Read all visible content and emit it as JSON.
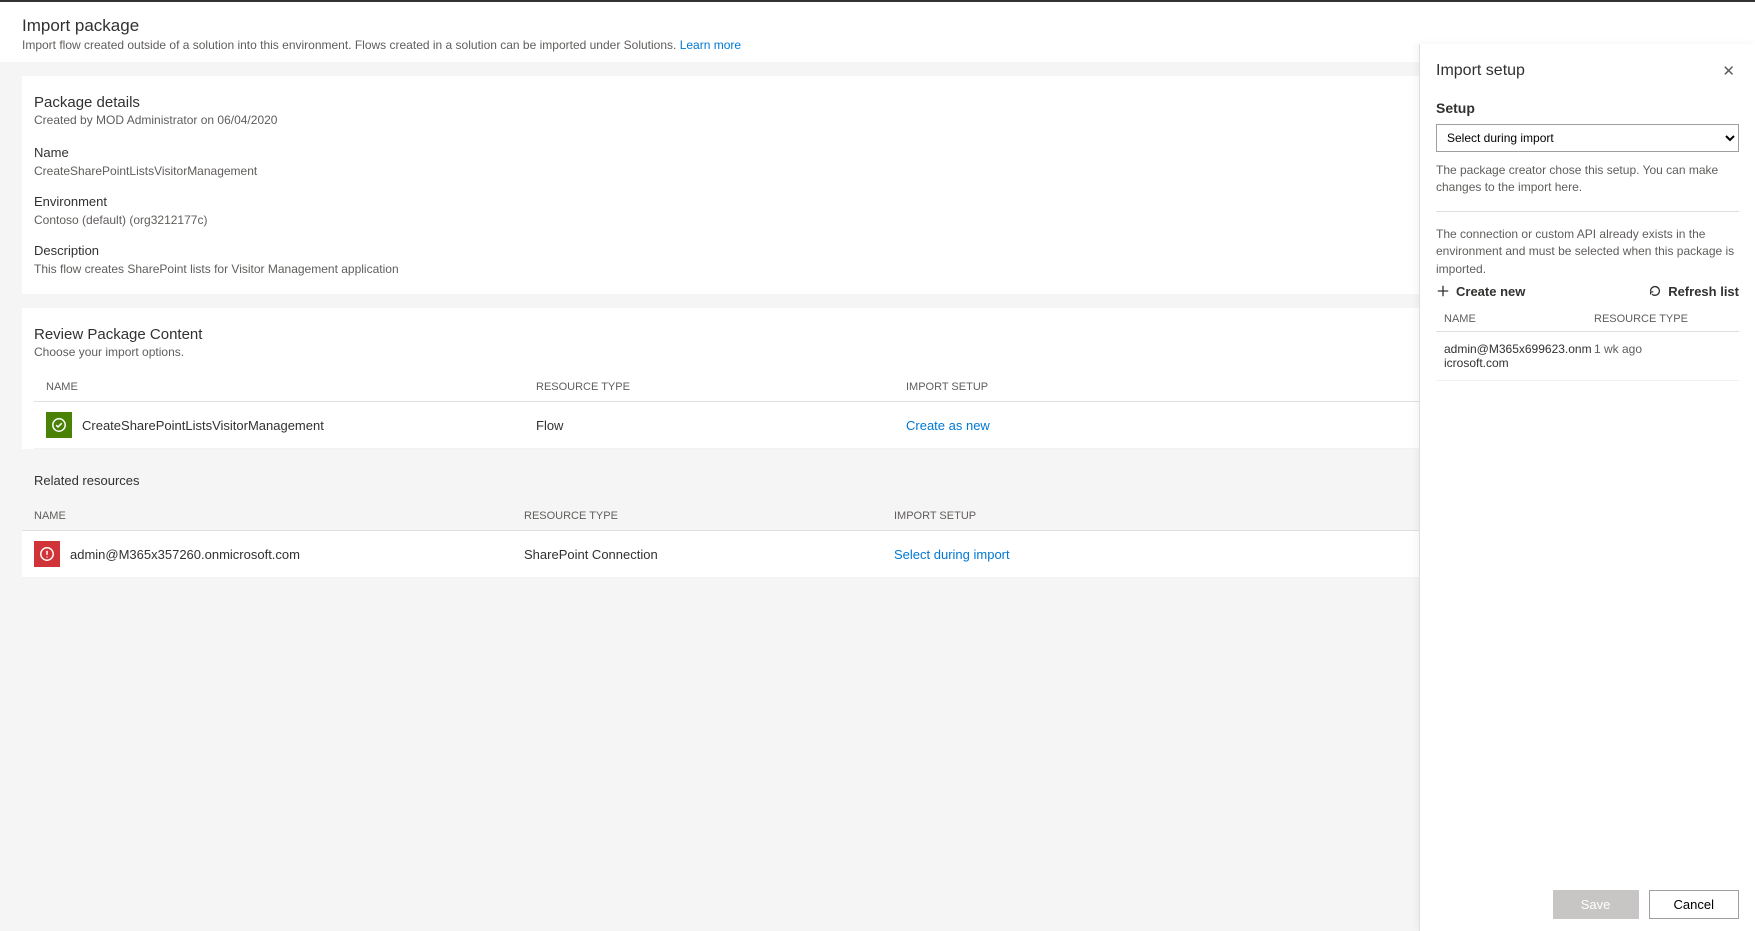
{
  "header": {
    "title": "Import package",
    "subtitle_pre": "Import flow created outside of a solution into this environment. Flows created in a solution can be imported under Solutions. ",
    "learn_more": "Learn more"
  },
  "details": {
    "section_title": "Package details",
    "created_by": "Created by MOD Administrator on 06/04/2020",
    "name_label": "Name",
    "name_value": "CreateSharePointListsVisitorManagement",
    "env_label": "Environment",
    "env_value": "Contoso (default) (org3212177c)",
    "desc_label": "Description",
    "desc_value": "This flow creates SharePoint lists for Visitor Management application"
  },
  "review": {
    "title": "Review Package Content",
    "subtitle": "Choose your import options.",
    "columns": {
      "name": "NAME",
      "type": "RESOURCE TYPE",
      "setup": "IMPORT SETUP"
    },
    "rows": [
      {
        "icon": "ok",
        "name": "CreateSharePointListsVisitorManagement",
        "type": "Flow",
        "setup": "Create as new"
      }
    ]
  },
  "related": {
    "title": "Related resources",
    "columns": {
      "name": "NAME",
      "type": "RESOURCE TYPE",
      "setup": "IMPORT SETUP"
    },
    "rows": [
      {
        "icon": "err",
        "name": "admin@M365x357260.onmicrosoft.com",
        "type": "SharePoint Connection",
        "setup": "Select during import"
      }
    ]
  },
  "panel": {
    "title": "Import setup",
    "setup_label": "Setup",
    "setup_selected": "Select during import",
    "help1": "The package creator chose this setup. You can make changes to the import here.",
    "help2": "The connection or custom API already exists in the environment and must be selected when this package is imported.",
    "create_new": "Create new",
    "refresh_list": "Refresh list",
    "columns": {
      "name": "NAME",
      "type": "RESOURCE TYPE"
    },
    "rows": [
      {
        "name": "admin@M365x699623.onmicrosoft.com",
        "type": "1 wk ago"
      }
    ],
    "save": "Save",
    "cancel": "Cancel"
  }
}
